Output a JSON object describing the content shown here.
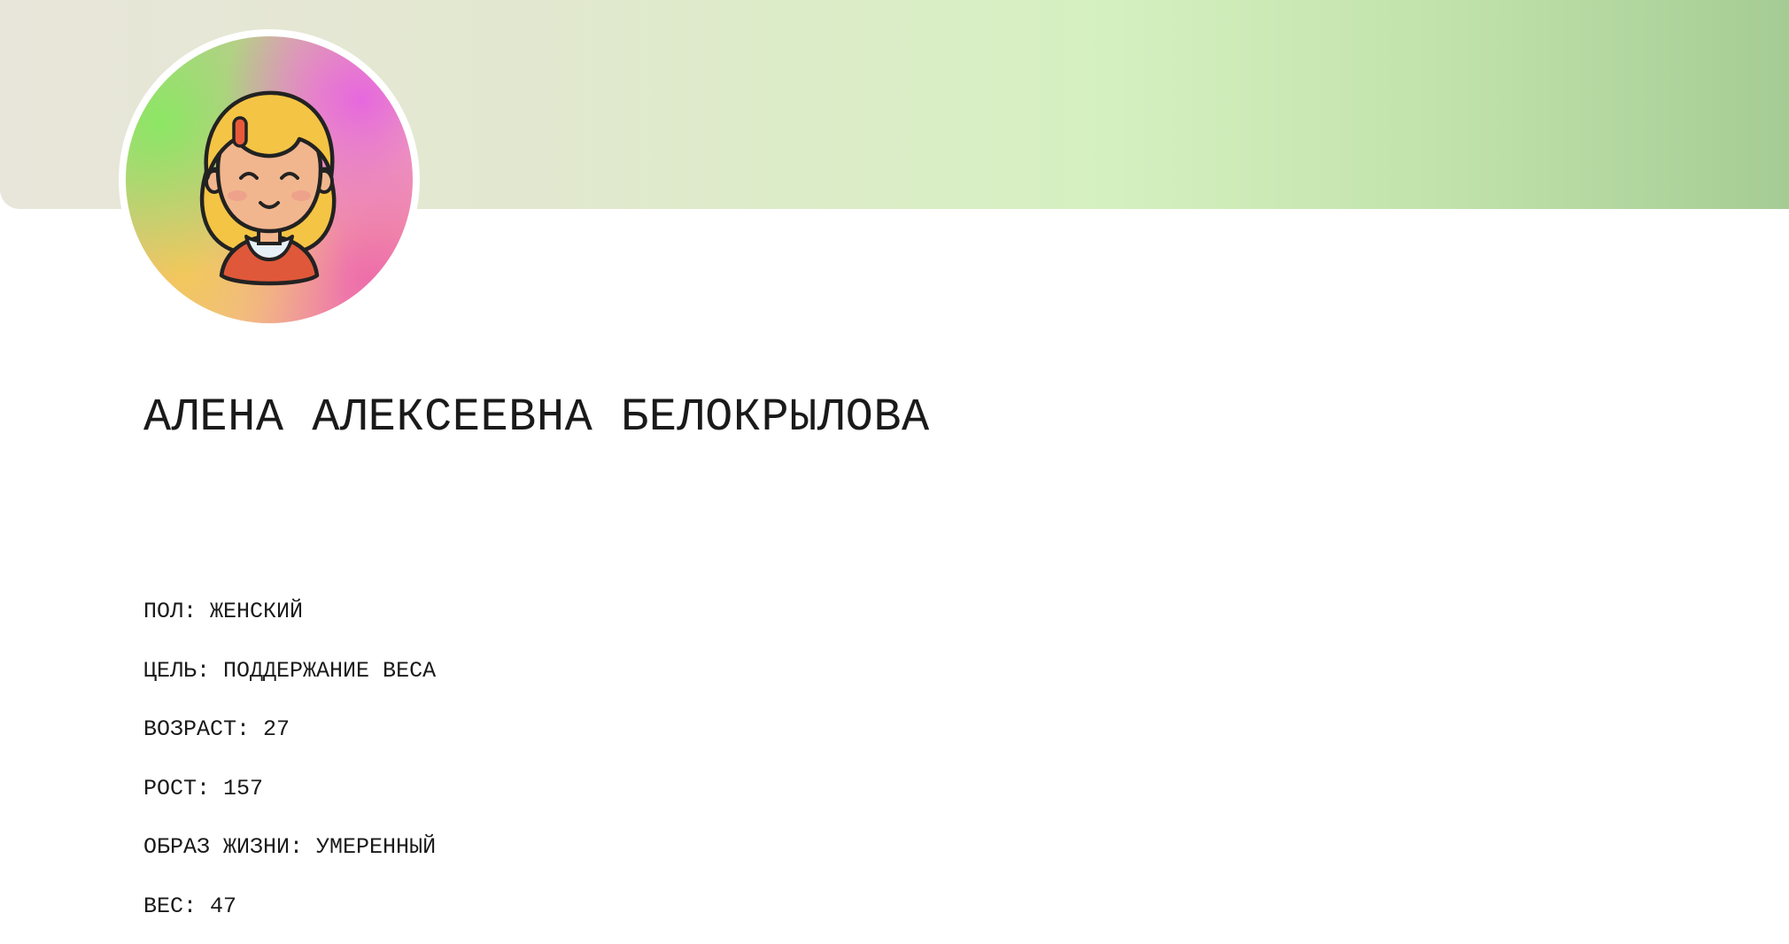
{
  "profile": {
    "full_name": "АЛЕНА АЛЕКСЕЕВНА БЕЛОКРЫЛОВА",
    "avatar_icon": "girl-avatar-icon",
    "details": [
      {
        "label": "ПОЛ",
        "value": "ЖЕНСКИЙ"
      },
      {
        "label": "ЦЕЛЬ",
        "value": "ПОДДЕРЖАНИЕ ВЕСА"
      },
      {
        "label": "ВОЗРАСТ",
        "value": "27"
      },
      {
        "label": "РОСТ",
        "value": "157"
      },
      {
        "label": "ОБРАЗ ЖИЗНИ",
        "value": "УМЕРЕННЫЙ"
      },
      {
        "label": "ВЕС",
        "value": "47"
      }
    ]
  },
  "colors": {
    "banner_start": "#e8e6da",
    "banner_mid": "#d5f0c0",
    "banner_end": "#a5cc94",
    "text": "#1a1a1a",
    "background": "#ffffff"
  }
}
